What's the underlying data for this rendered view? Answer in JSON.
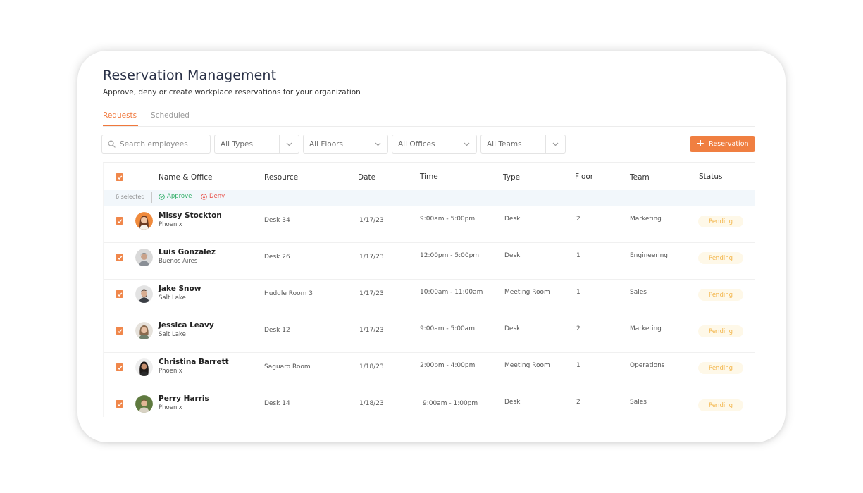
{
  "page": {
    "title": "Reservation Management",
    "subtitle": "Approve, deny or create workplace reservations for your organization"
  },
  "tabs": [
    {
      "label": "Requests",
      "active": true
    },
    {
      "label": "Scheduled",
      "active": false
    }
  ],
  "filters": {
    "search_placeholder": "Search employees",
    "types": "All Types",
    "floors": "All Floors",
    "offices": "All Offices",
    "teams": "All Teams"
  },
  "toolbar": {
    "reservation_label": "Reservation"
  },
  "table": {
    "headers": {
      "name": "Name & Office",
      "resource": "Resource",
      "date": "Date",
      "time": "Time",
      "type": "Type",
      "floor": "Floor",
      "team": "Team",
      "status": "Status"
    },
    "selection": {
      "count_text": "6 selected",
      "approve": "Approve",
      "deny": "Deny"
    },
    "rows": [
      {
        "name": "Missy Stockton",
        "office": "Phoenix",
        "resource": "Desk 34",
        "date": "1/17/23",
        "time": "9:00am - 5:00pm",
        "type": "Desk",
        "floor": "2",
        "team": "Marketing",
        "status": "Pending"
      },
      {
        "name": "Luis Gonzalez",
        "office": "Buenos Aires",
        "resource": "Desk 26",
        "date": "1/17/23",
        "time": "12:00pm - 5:00pm",
        "type": "Desk",
        "floor": "1",
        "team": "Engineering",
        "status": "Pending"
      },
      {
        "name": "Jake Snow",
        "office": "Salt Lake",
        "resource": "Huddle Room 3",
        "date": "1/17/23",
        "time": "10:00am - 11:00am",
        "type": "Meeting Room",
        "floor": "1",
        "team": "Sales",
        "status": "Pending"
      },
      {
        "name": "Jessica Leavy",
        "office": "Salt Lake",
        "resource": "Desk 12",
        "date": "1/17/23",
        "time": "9:00am - 5:00am",
        "type": "Desk",
        "floor": "2",
        "team": "Marketing",
        "status": "Pending"
      },
      {
        "name": "Christina Barrett",
        "office": "Phoenix",
        "resource": "Saguaro Room",
        "date": "1/18/23",
        "time": "2:00pm - 4:00pm",
        "type": "Meeting Room",
        "floor": "1",
        "team": "Operations",
        "status": "Pending"
      },
      {
        "name": "Perry Harris",
        "office": "Phoenix",
        "resource": "Desk 14",
        "date": "1/18/23",
        "time": "9:00am - 1:00pm",
        "type": "Desk",
        "floor": "2",
        "team": "Sales",
        "status": "Pending"
      }
    ]
  },
  "colors": {
    "accent": "#f07f41",
    "approve": "#2fae66",
    "deny": "#e8514a",
    "pending_text": "#f3b54a",
    "pending_bg": "#fef8e8"
  },
  "icons": {
    "search": "search-icon",
    "chevron": "chevron-down-icon",
    "plus": "plus-icon",
    "approve": "check-circle-icon",
    "deny": "x-circle-icon",
    "checkbox": "check-icon",
    "avatar": "avatar-photo"
  }
}
